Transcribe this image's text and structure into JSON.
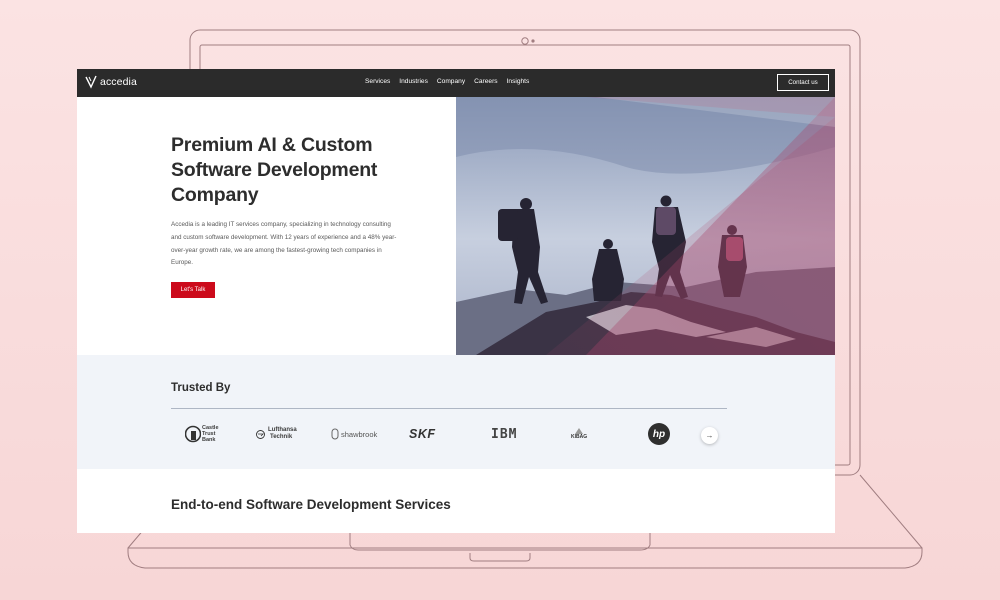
{
  "nav": {
    "logo_text": "accedia",
    "links": [
      "Services",
      "Industries",
      "Company",
      "Careers",
      "Insights"
    ],
    "contact_label": "Contact us"
  },
  "hero": {
    "title": "Premium AI & Custom Software Development Company",
    "description": "Accedia is a leading IT services company, specializing in technology consulting and custom software development. With 12 years of experience and a 48% year-over-year growth rate, we are among the fastest-growing tech companies in Europe.",
    "cta_label": "Let's Talk"
  },
  "trusted": {
    "title": "Trusted By",
    "logos": {
      "castle_line1": "Castle",
      "castle_line2": "Trust",
      "castle_line3": "Bank",
      "lufthansa_line1": "Lufthansa",
      "lufthansa_line2": "Technik",
      "shawbrook": "shawbrook",
      "skf": "SKF",
      "ibm": "IBM",
      "kibag": "KIBAG",
      "hp": "hp"
    },
    "next_arrow": "→"
  },
  "services": {
    "title": "End-to-end Software Development Services"
  },
  "colors": {
    "nav_bg": "#2b2b2b",
    "accent_red": "#cc0a1b",
    "trusted_bg": "#f1f4f9",
    "page_bg": "#f7d6d6"
  }
}
